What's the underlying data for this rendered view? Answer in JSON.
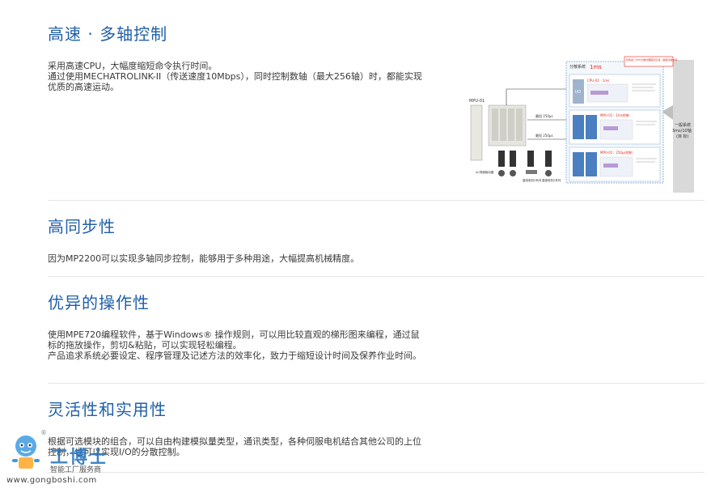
{
  "sections": [
    {
      "title": "高速 · 多轴控制",
      "paragraphs": [
        "采用高速CPU，大幅度缩短命令执行时间。",
        "通过使用MECHATROLINK-II（传送速度10Mbps），同时控制数轴（最大256轴）时，都能实现优质的高速运动。"
      ]
    },
    {
      "title": "高同步性",
      "paragraphs": [
        "因为MP2200可以实现多轴同步控制，能够用于多种用途，大幅提高机械精度。"
      ]
    },
    {
      "title": "优异的操作性",
      "paragraphs": [
        "使用MPE720编程软件，基于Windows® 操作规则，可以用比较直观的梯形图来编程，通过鼠标的拖放操作，剪切&粘贴，可以实现轻松编程。",
        "产品追求系统必要设定、程序管理及记述方法的效率化，致力于缩短设计时间及保养作业时间。"
      ]
    },
    {
      "title": "灵活性和实用性",
      "paragraphs": [
        "根据可选模块的组合，可以自由构建模拟量类型，通讯类型，各种伺服电机结合其他公司的上位控制，也可以实现I/O的分散控制。"
      ]
    }
  ],
  "diagram": {
    "title_prefix": "分散系统",
    "title_value": "1ms",
    "note": "利用多个CPU分散处理程序负载，缩短扫描时间",
    "side_label_1": "一般系统",
    "side_label_2": "3ms/10轴",
    "side_label_3": "(目 标)",
    "module_label": "MPU-01",
    "speed_1": "最短 250μs",
    "speed_2": "最短 250μs",
    "io_label": "I/O",
    "cpu_label_1": "CPU-01：1ms",
    "mpu_label_2": "MPU-01：1ms控制",
    "mpu_label_3": "MPU-01：250μs控制",
    "block_a": "运动",
    "block_b": "运动控制",
    "block_c": "运动控制",
    "ac_label": "AC伺服驱动器",
    "motor_label_1": "直线电机Σ系列",
    "motor_label_2": "直驱电机Σ系列",
    "colors": {
      "accent_red": "#e0281c",
      "box_blue": "#2a73c4",
      "grey_band": "#d9d9d9"
    }
  },
  "watermark": {
    "brand": "工博士",
    "subtitle": "智能工厂服务商",
    "url": "www.gongboshi.com",
    "registered": "®"
  }
}
